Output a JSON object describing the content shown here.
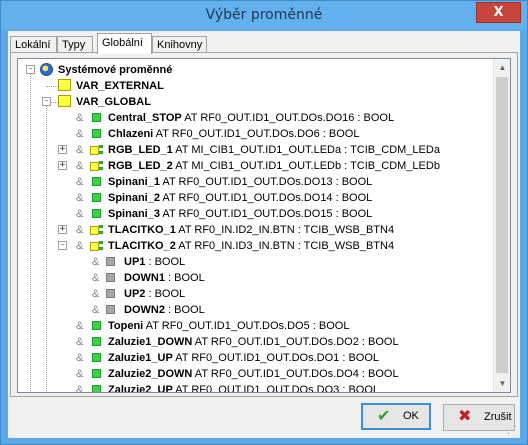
{
  "window": {
    "title": "Výběr proměnné",
    "close_label": "X"
  },
  "tabs": [
    "Lokální",
    "Typy",
    "Globální",
    "Knihovny"
  ],
  "active_tab": "Globální",
  "tree": {
    "root": "Systémové proměnné",
    "nodes": [
      {
        "label": "VAR_EXTERNAL"
      },
      {
        "label": "VAR_GLOBAL"
      }
    ],
    "items": [
      {
        "name": "Central_STOP",
        "decl": "AT RF0_OUT.ID1_OUT.DOs.DO16 : BOOL",
        "icon": "bool-var-icon",
        "expander": ""
      },
      {
        "name": "Chlazeni",
        "decl": "AT RF0_OUT.ID1_OUT.DOs.DO6 : BOOL",
        "icon": "bool-var-icon",
        "expander": ""
      },
      {
        "name": "RGB_LED_1",
        "decl": "AT MI_CIB1_OUT.ID1_OUT.LEDa : TCIB_CDM_LEDa",
        "icon": "struct-var-icon",
        "expander": "+"
      },
      {
        "name": "RGB_LED_2",
        "decl": "AT MI_CIB1_OUT.ID1_OUT.LEDb : TCIB_CDM_LEDb",
        "icon": "struct-var-icon",
        "expander": "+"
      },
      {
        "name": "Spinani_1",
        "decl": "AT RF0_OUT.ID1_OUT.DOs.DO13 : BOOL",
        "icon": "bool-var-icon",
        "expander": ""
      },
      {
        "name": "Spinani_2",
        "decl": "AT RF0_OUT.ID1_OUT.DOs.DO14 : BOOL",
        "icon": "bool-var-icon",
        "expander": ""
      },
      {
        "name": "Spinani_3",
        "decl": "AT RF0_OUT.ID1_OUT.DOs.DO15 : BOOL",
        "icon": "bool-var-icon",
        "expander": ""
      },
      {
        "name": "TLACITKO_1",
        "decl": "AT RF0_IN.ID2_IN.BTN : TCIB_WSB_BTN4",
        "icon": "struct-var-icon",
        "expander": "+"
      },
      {
        "name": "TLACITKO_2",
        "decl": "AT RF0_IN.ID3_IN.BTN : TCIB_WSB_BTN4",
        "icon": "struct-var-icon",
        "expander": "-"
      }
    ],
    "subitems": [
      {
        "name": "UP1",
        "decl": ": BOOL"
      },
      {
        "name": "DOWN1",
        "decl": ": BOOL"
      },
      {
        "name": "UP2",
        "decl": ": BOOL"
      },
      {
        "name": "DOWN2",
        "decl": ": BOOL"
      }
    ],
    "items_after": [
      {
        "name": "Topeni",
        "decl": "AT RF0_OUT.ID1_OUT.DOs.DO5 : BOOL"
      },
      {
        "name": "Zaluzie1_DOWN",
        "decl": "AT RF0_OUT.ID1_OUT.DOs.DO2 : BOOL"
      },
      {
        "name": "Zaluzie1_UP",
        "decl": "AT RF0_OUT.ID1_OUT.DOs.DO1 : BOOL"
      },
      {
        "name": "Zaluzie2_DOWN",
        "decl": "AT RF0_OUT.ID1_OUT.DOs.DO4 : BOOL"
      },
      {
        "name": "Zaluzie2_UP",
        "decl": "AT RF0_OUT.ID1_OUT.DOs.DO3 : BOOL"
      }
    ]
  },
  "buttons": {
    "ok": "OK",
    "cancel": "Zrušit"
  },
  "colors": {
    "title_bar": "#63b0ee",
    "close": "#c7453a",
    "bool_icon": "#3ad24a",
    "folder_icon": "#ffff40"
  }
}
